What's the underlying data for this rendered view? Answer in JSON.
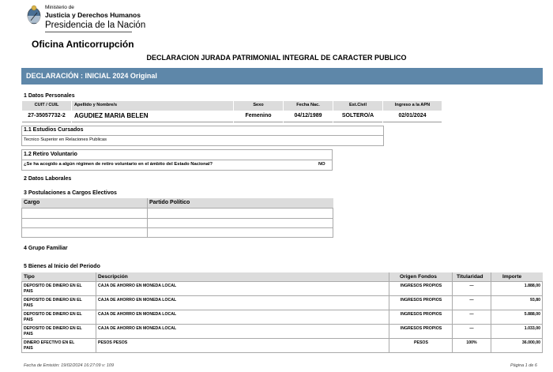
{
  "header": {
    "ministry_line1": "Ministerio de",
    "ministry_line2": "Justicia y Derechos Humanos",
    "ministry_line3": "Presidencia de la Nación",
    "office": "Oficina Anticorrupción",
    "document_title": "DECLARACION JURADA PATRIMONIAL INTEGRAL DE CARACTER PUBLICO",
    "banner": "DECLARACIÓN :  INICIAL 2024 Original"
  },
  "personal": {
    "section_title": "1 Datos Personales",
    "headers": [
      "CUIT / CUIL",
      "Apellido y Nombre/s",
      "Sexo",
      "Fecha Nac.",
      "Est.Civil",
      "Ingreso a la APN"
    ],
    "values": [
      "27-35057732-2",
      "AGUDIEZ MARIA BELEN",
      "Femenino",
      "04/12/1989",
      "SOLTERO/A",
      "02/01/2024"
    ]
  },
  "studies": {
    "title": "1.1 Estudios Cursados",
    "value": "Tecnico Superior en Relaciones Publicas"
  },
  "retirement": {
    "title": "1.2 Retiro Voluntario",
    "question": "¿Se ha acogido a algún régimen de retiro voluntario en el ámbito del Estado Nacional?",
    "answer": "NO"
  },
  "labor": {
    "title": "2 Datos Laborales"
  },
  "candidacies": {
    "title": "3 Postulaciones a Cargos Electivos",
    "col_cargo": "Cargo",
    "col_partido": "Partido Político"
  },
  "family": {
    "title": "4 Grupo Familiar"
  },
  "assets": {
    "title": "5 Bienes al Inicio del Periodo",
    "headers": {
      "tipo": "Tipo",
      "descripcion": "Descripción",
      "origen": "Origen Fondos",
      "titularidad": "Titularidad",
      "importe": "Importe"
    },
    "rows": [
      {
        "tipo1": "DEPOSITO DE DINERO EN EL",
        "tipo2": "PAIS",
        "descripcion": "CAJA DE AHORRO EN MONEDA LOCAL",
        "origen": "INGRESOS PROPIOS",
        "titularidad": "—",
        "importe": "1.888,00"
      },
      {
        "tipo1": "DEPOSITO DE DINERO EN EL",
        "tipo2": "PAIS",
        "descripcion": "CAJA DE AHORRO EN MONEDA LOCAL",
        "origen": "INGRESOS PROPIOS",
        "titularidad": "—",
        "importe": "93,80"
      },
      {
        "tipo1": "DEPOSITO DE DINERO EN EL",
        "tipo2": "PAIS",
        "descripcion": "CAJA DE AHORRO EN MONEDA LOCAL",
        "origen": "INGRESOS PROPIOS",
        "titularidad": "—",
        "importe": "5.888,00"
      },
      {
        "tipo1": "DEPOSITO DE DINERO EN EL",
        "tipo2": "PAIS",
        "descripcion": "CAJA DE AHORRO EN MONEDA LOCAL",
        "origen": "INGRESOS PROPIOS",
        "titularidad": "—",
        "importe": "1.033,00"
      },
      {
        "tipo1": "DINERO EFECTIVO EN EL",
        "tipo2": "PAIS",
        "descripcion": "PESOS PESOS",
        "origen": "PESOS",
        "titularidad": "100%",
        "importe": "36.000,00"
      }
    ]
  },
  "footer": {
    "emission": "Fecha de Emisión: 19/02/2024 16:27:09     v: 109",
    "page": "Página 1 de 6"
  },
  "colors": {
    "banner": "#5e87a9",
    "header_gray": "#dcdcdc"
  }
}
